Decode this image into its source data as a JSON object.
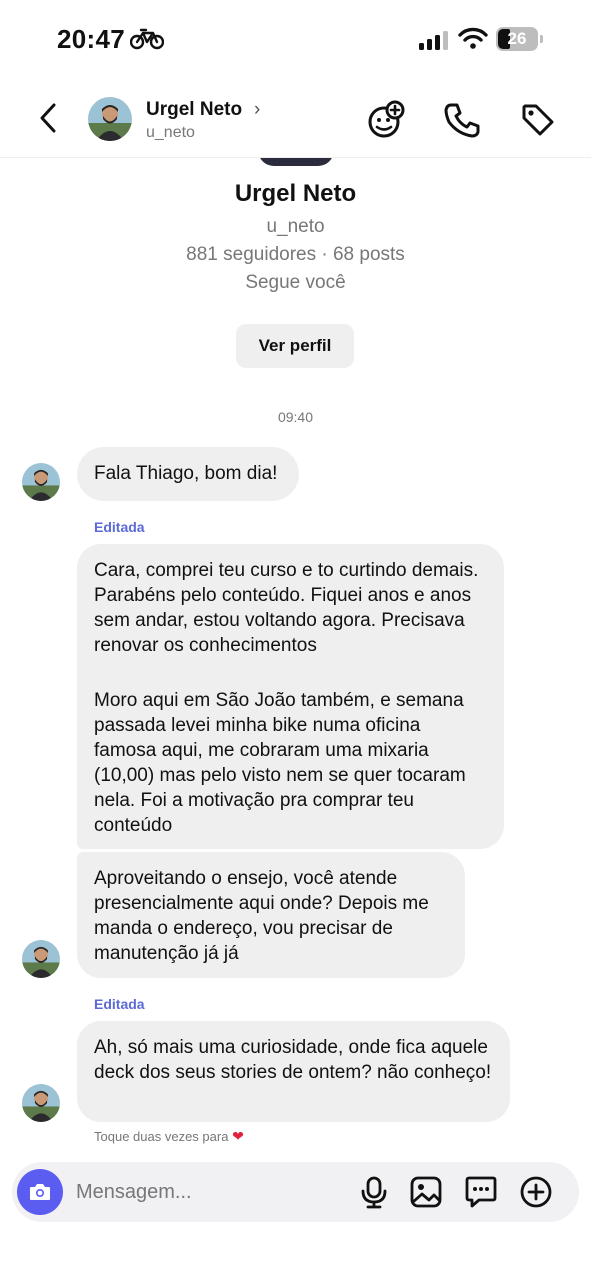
{
  "status_bar": {
    "time": "20:47",
    "battery_level": "26",
    "icons": [
      "bike-icon",
      "signal-icon",
      "wifi-icon",
      "battery-icon"
    ]
  },
  "header": {
    "name": "Urgel Neto",
    "chevron": "›",
    "username": "u_neto",
    "icons": [
      "back-icon",
      "add-effect-icon",
      "phone-icon",
      "tag-icon"
    ]
  },
  "profile": {
    "name": "Urgel Neto",
    "username": "u_neto",
    "stats": "881 seguidores · 68 posts",
    "follows_you": "Segue você",
    "view_profile_label": "Ver perfil"
  },
  "timestamp": "09:40",
  "messages": [
    {
      "text": "Fala Thiago, bom dia!"
    },
    {
      "edited_label": "Editada",
      "paragraphs": [
        "Cara, comprei teu curso e to curtindo demais. Parabéns pelo conteúdo.  Fiquei anos e anos sem andar, estou voltando agora. Precisava renovar os conhecimentos",
        "Moro aqui em São João também, e semana passada levei minha bike numa oficina famosa aqui, me cobraram uma mixaria (10,00) mas pelo visto nem se quer tocaram nela. Foi a motivação pra comprar teu conteúdo"
      ]
    },
    {
      "text": "Aproveitando o ensejo, você atende presencialmente aqui onde? Depois me manda o endereço, vou precisar de manutenção já já"
    },
    {
      "edited_label": "Editada",
      "text": "Ah, só mais uma curiosidade, onde fica aquele deck dos seus stories de ontem? não conheço!"
    }
  ],
  "double_tap_hint": "Toque duas vezes para",
  "composer": {
    "placeholder": "Mensagem...",
    "icons": [
      "camera-icon",
      "microphone-icon",
      "image-icon",
      "sticker-icon",
      "plus-icon"
    ]
  },
  "colors": {
    "accent": "#5b5cf0",
    "edited_label": "#5b6ad6",
    "bubble": "#efefef",
    "heart": "#e0213a"
  }
}
